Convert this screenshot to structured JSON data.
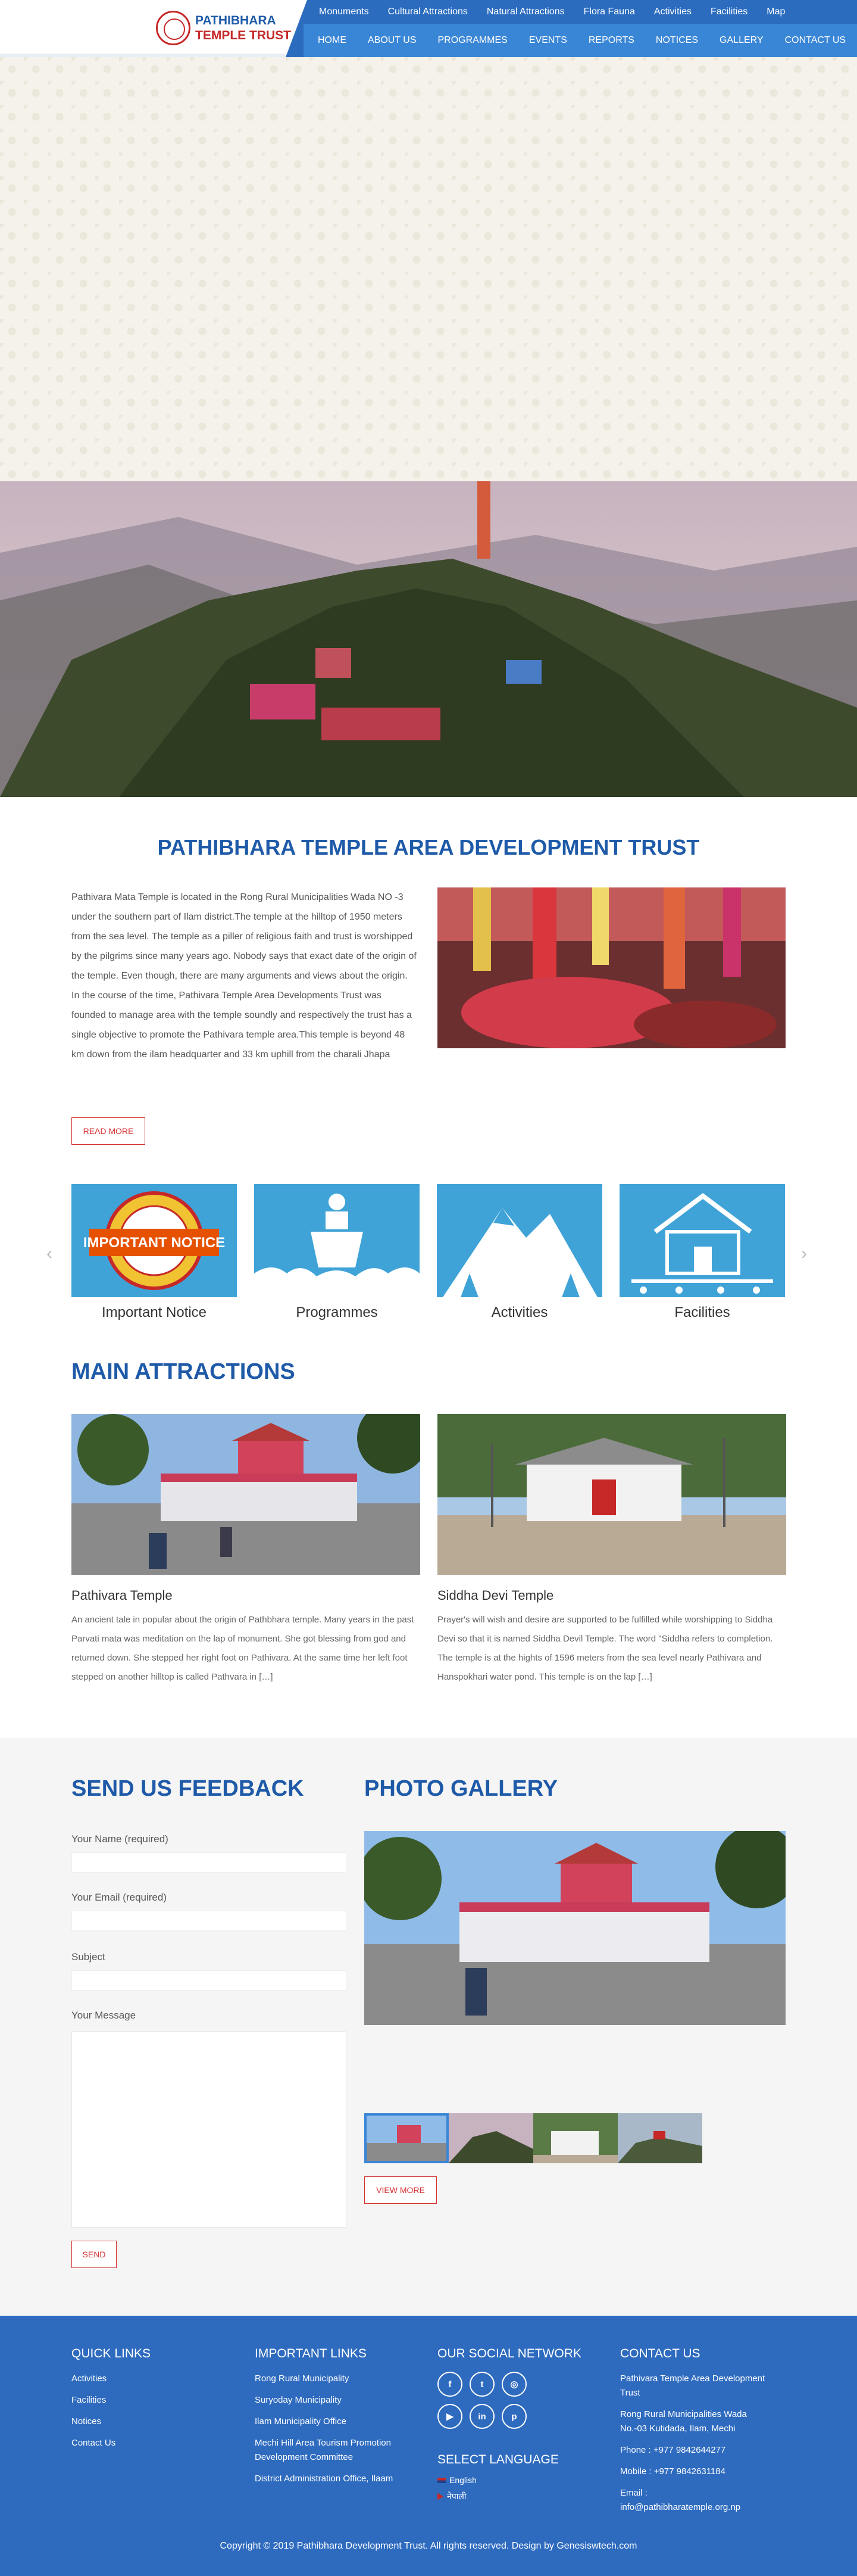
{
  "header": {
    "logo_line1": "PATHIBHARA",
    "logo_line2": "TEMPLE TRUST",
    "top_nav": [
      "Monuments",
      "Cultural Attractions",
      "Natural Attractions",
      "Flora Fauna",
      "Activities",
      "Facilities",
      "Map"
    ],
    "main_nav": [
      "HOME",
      "ABOUT US",
      "PROGRAMMES",
      "EVENTS",
      "REPORTS",
      "NOTICES",
      "GALLERY",
      "CONTACT US"
    ]
  },
  "intro": {
    "title": "PATHIBHARA TEMPLE AREA DEVELOPMENT TRUST",
    "text": "Pathivara Mata Temple is located in the Rong Rural Municipalities Wada NO -3 under the southern part of Ilam district.The temple at the hilltop of 1950 meters from the sea level. The temple as a piller of religious faith and trust is worshipped by the pilgrims since many years ago. Nobody says that exact date of the origin of the temple. Even though, there are many arguments and views about the origin. In the course of the time, Pathivara Temple Area Developments Trust was founded to manage area with the temple soundly and respectively the trust has a single objective to promote the Pathivara temple area.This temple is beyond 48 km down from the ilam headquarter and 33 km uphill from the charali Jhapa",
    "read_more": "READ MORE"
  },
  "features": [
    {
      "label": "Important Notice",
      "badge_line1": "IMPORTANT NOTICE",
      "icon": "notice-icon"
    },
    {
      "label": "Programmes",
      "icon": "podium-icon"
    },
    {
      "label": "Activities",
      "icon": "mountain-icon"
    },
    {
      "label": "Facilities",
      "icon": "house-icon"
    }
  ],
  "attractions": {
    "title": "MAIN ATTRACTIONS",
    "items": [
      {
        "name": "Pathivara Temple",
        "text": "An ancient tale in popular about the origin of Pathbhara temple. Many years in the past Parvati mata was meditation on the lap of monument. She got blessing from god and returned down. She stepped her right foot on Pathivara. At the same time her left foot stepped on another hilltop is called Pathvara in […]"
      },
      {
        "name": "Siddha Devi Temple",
        "text": "   Prayer's will wish and desire are supported to be fulfilled while worshipping to Siddha Devi so that it is named Siddha Devil Temple. The word \"Siddha refers to completion. The temple is at the hights of 1596 meters from the sea level nearly Pathivara and Hanspokhari water pond. This temple is on the lap […]"
      }
    ]
  },
  "feedback": {
    "title": "SEND US FEEDBACK",
    "name_label": "Your Name (required)",
    "email_label": "Your Email (required)",
    "subject_label": "Subject",
    "message_label": "Your Message",
    "send": "SEND"
  },
  "gallery": {
    "title": "PHOTO GALLERY",
    "view_more": "VIEW MORE"
  },
  "footer": {
    "quick_links_title": "QUICK LINKS",
    "quick_links": [
      "Activities",
      "Facilities",
      "Notices",
      "Contact Us"
    ],
    "important_title": "IMPORTANT LINKS",
    "important_links": [
      "Rong Rural Municipality",
      "Suryoday Municipality",
      "Ilam Municipality Office",
      "Mechi Hill Area Tourism Promotion Development Committee",
      "District Administration Office, Ilaam"
    ],
    "social_title": "OUR SOCIAL NETWORK",
    "social_icons": [
      "facebook-icon",
      "twitter-icon",
      "instagram-icon",
      "youtube-icon",
      "linkedin-icon",
      "pinterest-icon"
    ],
    "select_language": "SELECT LANGUAGE",
    "languages": [
      "English",
      "नेपाली"
    ],
    "contact_title": "CONTACT US",
    "contact_lines": [
      "Pathivara Temple Area Development Trust",
      "Rong Rural Municipalities Wada No.-03 Kutidada, Ilam, Mechi"
    ],
    "phone": "Phone : +977 9842644277",
    "mobile": "Mobile : +977 9842631184",
    "email_label": "Email :",
    "email": "info@pathibharatemple.org.np",
    "copyright": "Copyright © 2019 Pathibhara Development Trust. All rights reserved. Design by Genesiswtech.com"
  }
}
